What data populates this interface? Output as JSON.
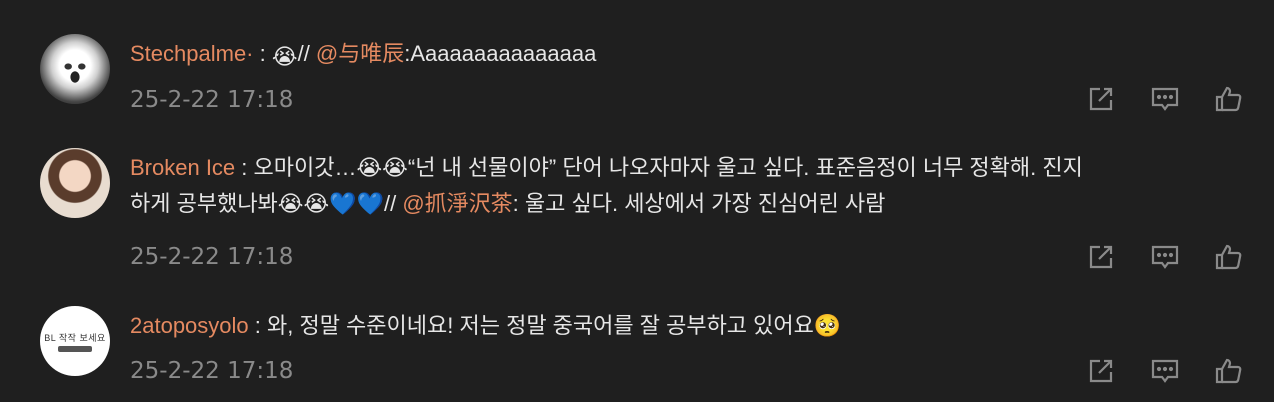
{
  "comments": [
    {
      "username": "Stechpalme·",
      "sep": " : ",
      "text_before": "",
      "emoji_after_sep": "😭",
      "slashes": "// ",
      "mention": "@与唯辰",
      "after_mention": ":Aaaaaaaaaaaaaaa",
      "time": "25-2-22 17:18"
    },
    {
      "username": "Broken Ice",
      "sep": " : ",
      "line1": "오마이갓…😭😭“넌 내 선물이야” 단어 나오자마자 울고 싶다. 표준음정이 너무 정확해. 진지",
      "line2_before": "하게 공부했나봐😭😭💙💙// ",
      "mention": "@抓淨沢茶",
      "after_mention": ": 울고 싶다. 세상에서 가장 진심어린 사람",
      "time": "25-2-22 17:18"
    },
    {
      "username": "2atoposyolo",
      "sep": " : ",
      "text": "와, 정말 수준이네요! 저는 정말 중국어를 잘 공부하고 있어요🥺",
      "time": "25-2-22 17:18",
      "avatar_text": "BL 작작 보세요"
    }
  ],
  "icons": [
    "share-icon",
    "comment-icon",
    "like-icon"
  ]
}
